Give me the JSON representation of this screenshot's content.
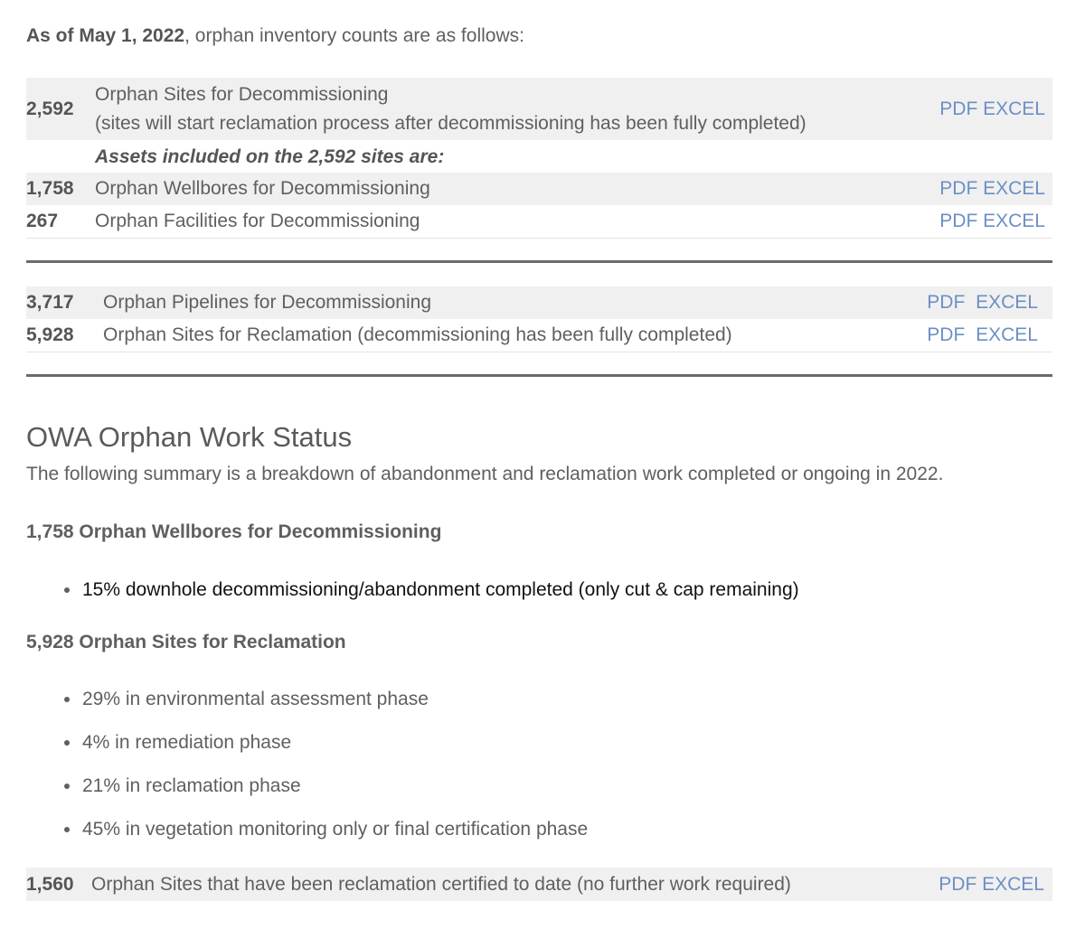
{
  "intro": {
    "date_bold": "As of May 1, 2022",
    "rest": ", orphan inventory counts are as follows:"
  },
  "table1": {
    "sites": {
      "count": "2,592",
      "label": "Orphan Sites for Decommissioning",
      "note": "(sites will start reclamation process after decommissioning has been fully completed)",
      "pdf": "PDF",
      "excel": "EXCEL"
    },
    "assets_heading": "Assets included on the 2,592 sites are:",
    "wellbores": {
      "count": "1,758",
      "label": "Orphan Wellbores for Decommissioning",
      "pdf": "PDF",
      "excel": "EXCEL"
    },
    "facilities": {
      "count": "267",
      "label": "Orphan Facilities for Decommissioning",
      "pdf": "PDF",
      "excel": "EXCEL"
    }
  },
  "table2": {
    "pipelines": {
      "count": "3,717",
      "label": "Orphan Pipelines for Decommissioning",
      "pdf": "PDF",
      "excel": "EXCEL"
    },
    "reclamation": {
      "count": "5,928",
      "label": "Orphan Sites for Reclamation (decommissioning has been fully completed)",
      "pdf": "PDF",
      "excel": "EXCEL"
    }
  },
  "status": {
    "heading": "OWA Orphan Work Status",
    "summary": "The following summary is a breakdown of abandonment and reclamation work completed or ongoing in 2022.",
    "wellbores_heading": "1,758 Orphan Wellbores for Decommissioning",
    "wellbores_items": [
      "15% downhole decommissioning/abandonment completed (only cut & cap remaining)"
    ],
    "reclamation_heading": "5,928 Orphan Sites for Reclamation",
    "reclamation_items": [
      "29% in environmental assessment phase",
      "4% in remediation phase",
      "21% in reclamation phase",
      "45% in vegetation monitoring only or final certification phase"
    ],
    "certified": {
      "count": "1,560",
      "label": "Orphan Sites that have been reclamation certified to date (no further work required)",
      "pdf": "PDF",
      "excel": "EXCEL"
    }
  },
  "colors": {
    "link": "#6c8fc5",
    "text": "#5f5f5f",
    "row_shade": "#f0f0f0",
    "rule": "#6b6b6b"
  }
}
